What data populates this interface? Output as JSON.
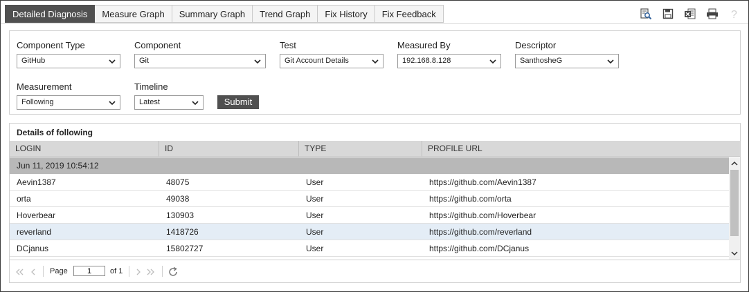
{
  "tabs": [
    {
      "label": "Detailed Diagnosis",
      "active": true
    },
    {
      "label": "Measure Graph"
    },
    {
      "label": "Summary Graph"
    },
    {
      "label": "Trend Graph"
    },
    {
      "label": "Fix History"
    },
    {
      "label": "Fix Feedback"
    }
  ],
  "toolbar": {
    "icons": [
      "search-report-icon",
      "save-icon",
      "excel-export-icon",
      "print-icon",
      "help-icon"
    ]
  },
  "filters": {
    "component_type": {
      "label": "Component Type",
      "value": "GitHub"
    },
    "component": {
      "label": "Component",
      "value": "Git"
    },
    "test": {
      "label": "Test",
      "value": "Git Account Details"
    },
    "measured_by": {
      "label": "Measured By",
      "value": "192.168.8.128"
    },
    "descriptor": {
      "label": "Descriptor",
      "value": "SanthosheG"
    },
    "measurement": {
      "label": "Measurement",
      "value": "Following"
    },
    "timeline": {
      "label": "Timeline",
      "value": "Latest"
    },
    "submit_label": "Submit"
  },
  "grid": {
    "title": "Details of following",
    "columns": [
      "LOGIN",
      "ID",
      "TYPE",
      "PROFILE URL"
    ],
    "group_label": "Jun 11, 2019 10:54:12",
    "rows": [
      {
        "login": "Aevin1387",
        "id": "48075",
        "type": "User",
        "url": "https://github.com/Aevin1387"
      },
      {
        "login": "orta",
        "id": "49038",
        "type": "User",
        "url": "https://github.com/orta"
      },
      {
        "login": "Hoverbear",
        "id": "130903",
        "type": "User",
        "url": "https://github.com/Hoverbear"
      },
      {
        "login": "reverland",
        "id": "1418726",
        "type": "User",
        "url": "https://github.com/reverland",
        "selected": true
      },
      {
        "login": "DCjanus",
        "id": "15802727",
        "type": "User",
        "url": "https://github.com/DCjanus"
      }
    ]
  },
  "pager": {
    "page_label": "Page",
    "page_value": "1",
    "of_label": "of 1"
  },
  "colors": {
    "active_tab": "#505050",
    "group_row": "#b8b8b8",
    "selected_row": "#e4edf6",
    "header": "#d8d8d8"
  }
}
